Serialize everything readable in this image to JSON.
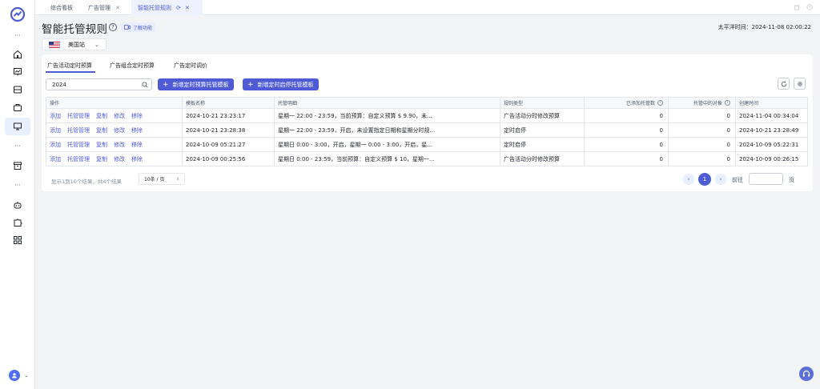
{
  "tabs": [
    {
      "label": "综合看板"
    },
    {
      "label": "广告管理"
    },
    {
      "label": "智能托管规则"
    }
  ],
  "header": {
    "title": "智能托管规则",
    "learn_label": "了解功能",
    "clock": "太平洋时间：2024-11-08 02:00:22",
    "store": "美国站"
  },
  "subtabs": [
    "广告活动定时预算",
    "广告组合定时预算",
    "广告定时调价"
  ],
  "search": {
    "value": "2024"
  },
  "buttons": {
    "add_budget_template": "新增定时预算托管模板",
    "add_startstop_template": "新增定时启停托管模板"
  },
  "table": {
    "headers": [
      "操作",
      "模板名称",
      "托管明细",
      "规则类型",
      "已添加托管数",
      "托管中的对象",
      "创建时间"
    ],
    "actions": [
      "添加",
      "托管管理",
      "复制",
      "修改",
      "移除"
    ],
    "rows": [
      {
        "name": "2024-10-21 23:23:17",
        "detail": "星期一  22:00 - 23:59，当前预算：自定义预算 $ 9.90，未...",
        "type": "广告活动分时修改预算",
        "added": "0",
        "active": "0",
        "created": "2024-11-04 00:34:04"
      },
      {
        "name": "2024-10-21 23:28:38",
        "detail": "星期一  22:00 - 23:59，开启，未设置指定日期和星期分时规...",
        "type": "定时启停",
        "added": "0",
        "active": "0",
        "created": "2024-10-21 23:28:49"
      },
      {
        "name": "2024-10-09 05:21:27",
        "detail": "星期日  0:00 - 3:00，开启，星期一  0:00 - 3:00，开启，星...",
        "type": "定时启停",
        "added": "0",
        "active": "0",
        "created": "2024-10-09 05:22:31"
      },
      {
        "name": "2024-10-09 00:25:56",
        "detail": "星期日  0:00 - 23:59，当前预算：自定义预算 $ 10，星期一...",
        "type": "广告活动分时修改预算",
        "added": "0",
        "active": "0",
        "created": "2024-10-09 00:26:15"
      }
    ]
  },
  "pagination": {
    "info": "显示1到10个结果，共4个结果",
    "page_size": "10条 / 页",
    "current": "1",
    "goto_label": "前往",
    "page_label": "页"
  },
  "colors": {
    "accent": "#4f5bd5",
    "border": "#e5e6eb",
    "background": "#f2f3f5"
  }
}
